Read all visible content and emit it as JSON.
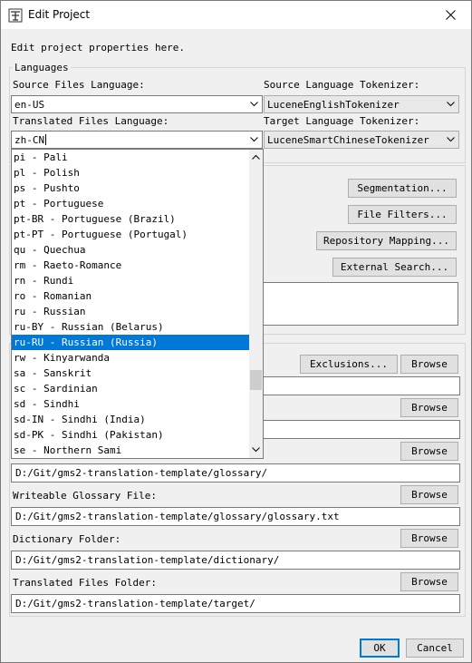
{
  "window": {
    "title": "Edit Project"
  },
  "intro": "Edit project properties here.",
  "languages": {
    "legend": "Languages",
    "source_language_label": "Source Files Language:",
    "source_language_value": "en-US",
    "source_tokenizer_label": "Source Language Tokenizer:",
    "source_tokenizer_value": "LuceneEnglishTokenizer",
    "translated_language_label": "Translated Files Language:",
    "translated_language_value": "zh-CN",
    "target_tokenizer_label": "Target Language Tokenizer:",
    "target_tokenizer_value": "LuceneSmartChineseTokenizer"
  },
  "language_dropdown": {
    "items": [
      "pi - Pali",
      "pl - Polish",
      "ps - Pushto",
      "pt - Portuguese",
      "pt-BR - Portuguese (Brazil)",
      "pt-PT - Portuguese (Portugal)",
      "qu - Quechua",
      "rm - Raeto-Romance",
      "rn - Rundi",
      "ro - Romanian",
      "ru - Russian",
      "ru-BY - Russian (Belarus)",
      "ru-RU - Russian (Russia)",
      "rw - Kinyarwanda",
      "sa - Sanskrit",
      "sc - Sardinian",
      "sd - Sindhi",
      "sd-IN - Sindhi (India)",
      "sd-PK - Sindhi (Pakistan)",
      "se - Northern Sami"
    ],
    "selected_index": 12
  },
  "options_buttons": {
    "segmentation": "Segmentation...",
    "file_filters": "File Filters...",
    "repository_mapping": "Repository Mapping...",
    "external_search": "External Search..."
  },
  "folders": {
    "exclusions_button": "Exclusions...",
    "browse_label": "Browse",
    "glossary_folder_value": "D:/Git/gms2-translation-template/glossary/",
    "writeable_glossary_label": "Writeable Glossary File:",
    "writeable_glossary_value": "D:/Git/gms2-translation-template/glossary/glossary.txt",
    "dictionary_label": "Dictionary Folder:",
    "dictionary_value": "D:/Git/gms2-translation-template/dictionary/",
    "translated_folder_label": "Translated Files Folder:",
    "translated_folder_value": "D:/Git/gms2-translation-template/target/"
  },
  "footer": {
    "ok_label": "OK",
    "cancel_label": "Cancel"
  },
  "colors": {
    "accent": "#0078d7",
    "selection_text": "#ffffff",
    "window_bg": "#f0f0f0"
  },
  "icons": {
    "app": "omegat-app-icon",
    "close": "close-icon",
    "dropdown": "chevron-down-icon"
  }
}
